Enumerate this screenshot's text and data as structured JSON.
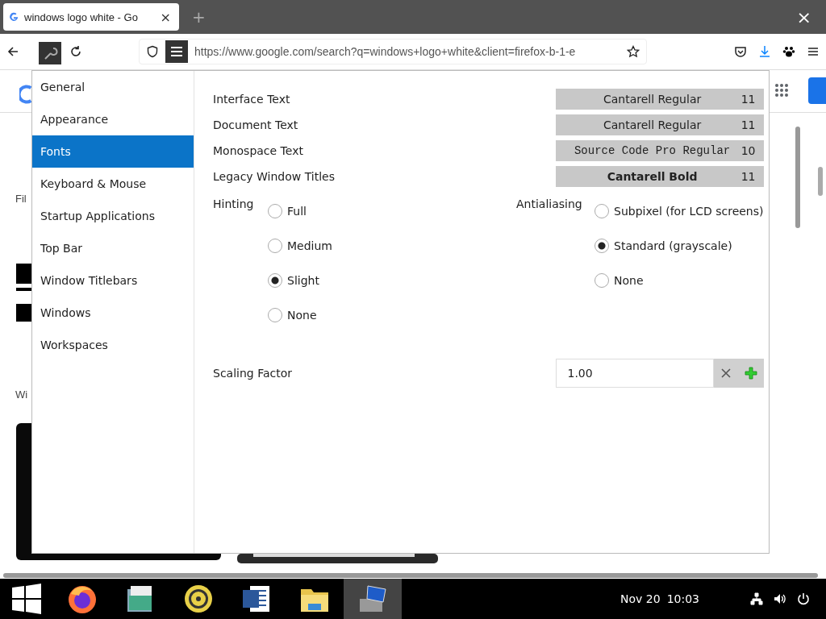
{
  "browser": {
    "tab": {
      "title": "windows logo white - Go",
      "close": "×",
      "selected": true
    },
    "new_tab": "+",
    "close_window": "×",
    "url": "https://www.google.com/search?q=windows+logo+white&client=firefox-b-1-e"
  },
  "background_page": {
    "texts": [
      "Fil",
      "Wi"
    ]
  },
  "dialog": {
    "sidebar": [
      {
        "label": "General",
        "selected": false
      },
      {
        "label": "Appearance",
        "selected": false
      },
      {
        "label": "Fonts",
        "selected": true
      },
      {
        "label": "Keyboard & Mouse",
        "selected": false
      },
      {
        "label": "Startup Applications",
        "selected": false
      },
      {
        "label": "Top Bar",
        "selected": false
      },
      {
        "label": "Window Titlebars",
        "selected": false
      },
      {
        "label": "Windows",
        "selected": false
      },
      {
        "label": "Workspaces",
        "selected": false
      }
    ],
    "fonts": [
      {
        "label": "Interface Text",
        "font": "Cantarell Regular",
        "size": "11",
        "kind": "regular"
      },
      {
        "label": "Document Text",
        "font": "Cantarell Regular",
        "size": "11",
        "kind": "regular"
      },
      {
        "label": "Monospace Text",
        "font": "Source Code Pro Regular",
        "size": "10",
        "kind": "mono"
      },
      {
        "label": "Legacy Window Titles",
        "font": "Cantarell Bold",
        "size": "11",
        "kind": "bold"
      }
    ],
    "hinting": {
      "label": "Hinting",
      "options": [
        {
          "label": "Full",
          "selected": false
        },
        {
          "label": "Medium",
          "selected": false
        },
        {
          "label": "Slight",
          "selected": true
        },
        {
          "label": "None",
          "selected": false
        }
      ]
    },
    "antialiasing": {
      "label": "Antialiasing",
      "options": [
        {
          "label": "Subpixel (for LCD screens)",
          "selected": false
        },
        {
          "label": "Standard (grayscale)",
          "selected": true
        },
        {
          "label": "None",
          "selected": false
        }
      ]
    },
    "scaling": {
      "label": "Scaling Factor",
      "value": "1.00"
    }
  },
  "taskbar": {
    "apps": [
      {
        "kind": "start",
        "selected": false
      },
      {
        "kind": "firefox",
        "selected": false
      },
      {
        "kind": "mail",
        "selected": false
      },
      {
        "kind": "speaker",
        "selected": false
      },
      {
        "kind": "document",
        "selected": false
      },
      {
        "kind": "folder",
        "selected": false
      },
      {
        "kind": "computer",
        "selected": true
      }
    ],
    "date": "Nov 20",
    "time": "10:03"
  }
}
